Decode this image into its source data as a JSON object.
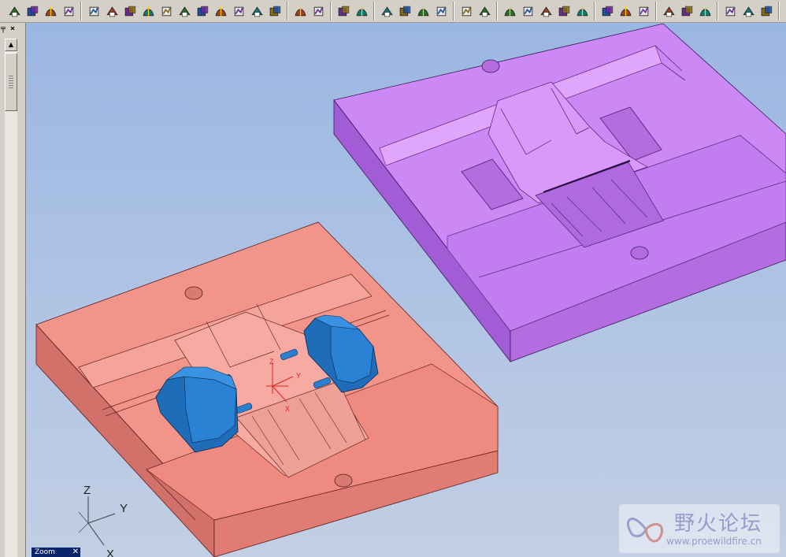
{
  "toolbar": {
    "groups": [
      [
        "sketch-icon",
        "extrude-icon",
        "revolve-icon",
        "datum-plane-icon"
      ],
      [
        "sweep-icon",
        "blend-icon",
        "round-icon",
        "chamfer-icon",
        "draft-icon",
        "shell-icon",
        "rib-icon",
        "hole-icon",
        "cut-icon",
        "pattern-icon",
        "mirror-icon"
      ],
      [
        "offset-icon",
        "thicken-icon"
      ],
      [
        "merge-icon",
        "trim-icon"
      ],
      [
        "copy-icon",
        "paste-icon",
        "move-icon",
        "rotate-icon"
      ],
      [
        "mold-component-icon",
        "mold-volume-icon"
      ],
      [
        "parting-surface-icon",
        "split-volume-icon",
        "extract-icon",
        "cavity-icon",
        "ejector-icon"
      ],
      [
        "view-front-icon",
        "view-top-icon",
        "view-right-icon"
      ],
      [
        "shaded-icon",
        "wireframe-icon",
        "hidden-line-icon"
      ],
      [
        "analysis-icon",
        "regenerate-icon",
        "measure-icon"
      ]
    ]
  },
  "left_panel": {
    "pin_label": "╤ ×"
  },
  "zoom_panel": {
    "label": "Zoom",
    "close": "✕"
  },
  "axis_indicator": {
    "z": "Z",
    "y": "Y",
    "x": "X"
  },
  "model_csys": {
    "z": "Z",
    "y": "Y",
    "x": "X"
  },
  "watermark": {
    "title": "野火论坛",
    "url": "www.proewildfire.cn"
  },
  "colors": {
    "viewport_top": "#9ab6e2",
    "viewport_bottom": "#c2cfe4",
    "core_top": "#f2948a",
    "core_side": "#d2706a",
    "cavity_top": "#cc88f4",
    "cavity_side": "#a25cd6",
    "slider": "#2a7fcf"
  }
}
